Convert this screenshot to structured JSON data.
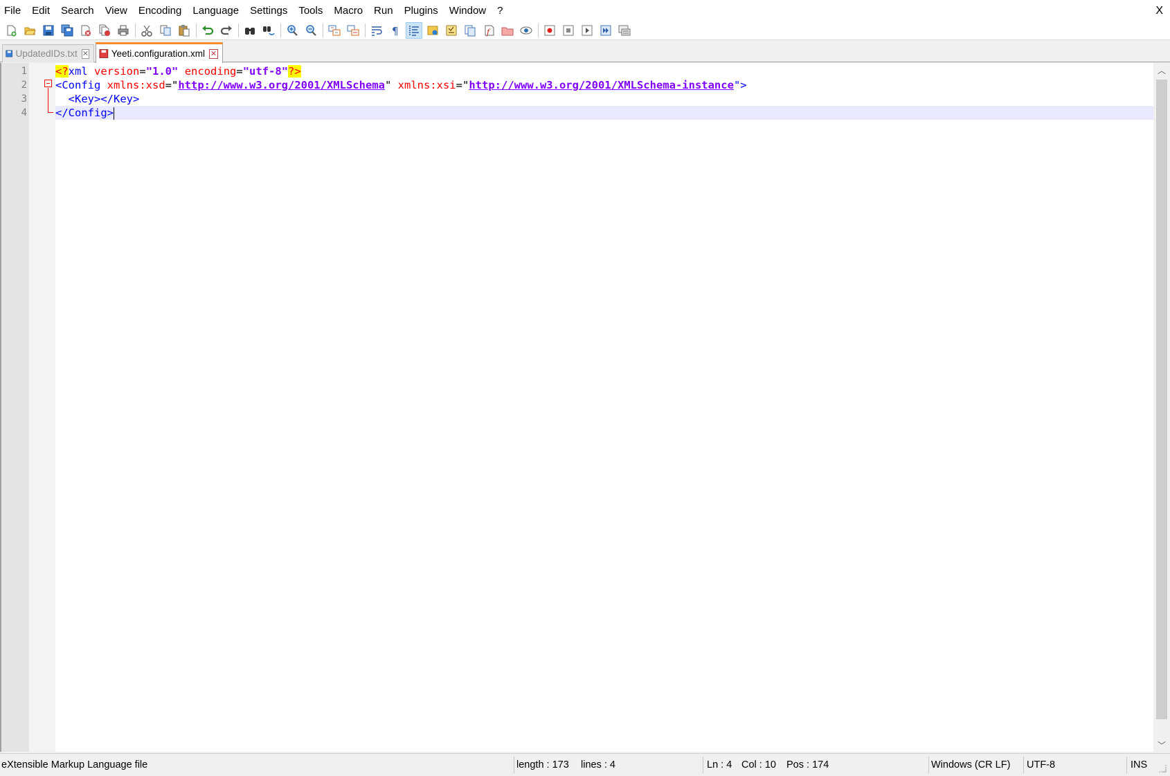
{
  "menu": {
    "items": [
      "File",
      "Edit",
      "Search",
      "View",
      "Encoding",
      "Language",
      "Settings",
      "Tools",
      "Macro",
      "Run",
      "Plugins",
      "Window",
      "?"
    ],
    "close_label": "X"
  },
  "toolbar": {
    "icons": [
      "new-file-icon",
      "open-file-icon",
      "save-icon",
      "save-all-icon",
      "close-icon",
      "close-all-icon",
      "print-icon",
      "cut-icon",
      "copy-icon",
      "paste-icon",
      "undo-icon",
      "redo-icon",
      "find-icon",
      "replace-icon",
      "zoom-in-icon",
      "zoom-out-icon",
      "sync-vertical-icon",
      "sync-horizontal-icon",
      "word-wrap-icon",
      "show-all-characters-icon",
      "indent-guide-icon",
      "user-defined-language-icon",
      "document-map-icon",
      "document-list-icon",
      "function-list-icon",
      "folder-as-workspace-icon",
      "monitoring-icon",
      "record-macro-icon",
      "stop-recording-icon",
      "playback-macro-icon",
      "run-macro-multiple-icon",
      "save-macro-icon"
    ]
  },
  "tabs": [
    {
      "label": "UpdatedIDs.txt",
      "active": false
    },
    {
      "label": "Yeeti.configuration.xml",
      "active": true
    }
  ],
  "editor": {
    "line_numbers": [
      "1",
      "2",
      "3",
      "4"
    ],
    "lines": {
      "l1": {
        "pi_open": "<?",
        "name": "xml",
        "attr1": "version",
        "eq1": "=",
        "val1": "\"1.0\"",
        "attr2": "encoding",
        "eq2": "=",
        "val2": "\"utf-8\"",
        "pi_close": "?>"
      },
      "l2": {
        "open": "<Config",
        "attr1": "xmlns:xsd",
        "eq1": "=\"",
        "url1": "http://www.w3.org/2001/XMLSchema",
        "q1": "\"",
        "attr2": "xmlns:xsi",
        "eq2": "=\"",
        "url2": "http://www.w3.org/2001/XMLSchema-instance",
        "close": "\">"
      },
      "l3": {
        "text": "<Key></Key>"
      },
      "l4": {
        "text": "</Config>"
      }
    }
  },
  "status": {
    "file_type": "eXtensible Markup Language file",
    "length": "length : 173",
    "lines": "lines : 4",
    "ln": "Ln : 4",
    "col": "Col : 10",
    "pos": "Pos : 174",
    "eol": "Windows (CR LF)",
    "encoding": "UTF-8",
    "mode": "INS"
  }
}
